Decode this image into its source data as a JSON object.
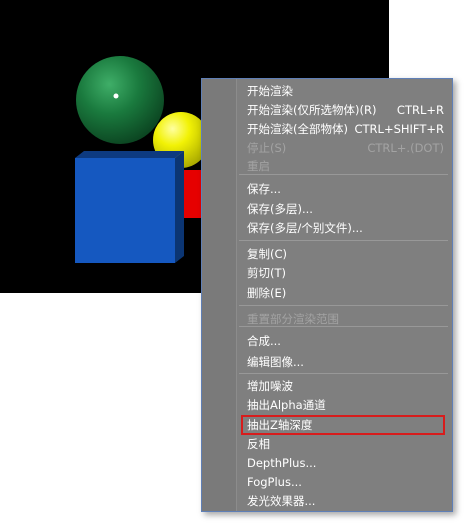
{
  "scene": {
    "objects": [
      {
        "name": "green-sphere",
        "color": "#1a7a3e"
      },
      {
        "name": "yellow-sphere",
        "color": "#f2f205"
      },
      {
        "name": "red-object",
        "color": "#e60000"
      },
      {
        "name": "blue-cube",
        "color": "#1558c0"
      }
    ]
  },
  "menu": {
    "items": [
      {
        "label": "开始渲染",
        "shortcut": "",
        "disabled": false
      },
      {
        "label": "开始渲染(仅所选物体)(R)",
        "shortcut": "CTRL+R",
        "disabled": false
      },
      {
        "label": "开始渲染(全部物体)",
        "shortcut": "CTRL+SHIFT+R",
        "disabled": false
      },
      {
        "label": "停止(S)",
        "shortcut": "CTRL+.(DOT)",
        "disabled": true
      },
      {
        "label": "重启",
        "shortcut": "",
        "disabled": true
      },
      {
        "label": "保存...",
        "shortcut": "",
        "disabled": false
      },
      {
        "label": "保存(多层)...",
        "shortcut": "",
        "disabled": false
      },
      {
        "label": "保存(多层/个别文件)...",
        "shortcut": "",
        "disabled": false
      },
      {
        "label": "复制(C)",
        "shortcut": "",
        "disabled": false
      },
      {
        "label": "剪切(T)",
        "shortcut": "",
        "disabled": false
      },
      {
        "label": "删除(E)",
        "shortcut": "",
        "disabled": false
      },
      {
        "label": "重置部分渲染范围",
        "shortcut": "",
        "disabled": true
      },
      {
        "label": "合成...",
        "shortcut": "",
        "disabled": false
      },
      {
        "label": "编辑图像...",
        "shortcut": "",
        "disabled": false
      },
      {
        "label": "增加噪波",
        "shortcut": "",
        "disabled": false
      },
      {
        "label": "抽出Alpha通道",
        "shortcut": "",
        "disabled": false
      },
      {
        "label": "抽出Z轴深度",
        "shortcut": "",
        "disabled": false
      },
      {
        "label": "反相",
        "shortcut": "",
        "disabled": false
      },
      {
        "label": "DepthPlus...",
        "shortcut": "",
        "disabled": false
      },
      {
        "label": "FogPlus...",
        "shortcut": "",
        "disabled": false
      },
      {
        "label": "发光效果器...",
        "shortcut": "",
        "disabled": false
      }
    ],
    "highlighted_item": "抽出Z轴深度",
    "highlight_color": "#d81c1c"
  }
}
